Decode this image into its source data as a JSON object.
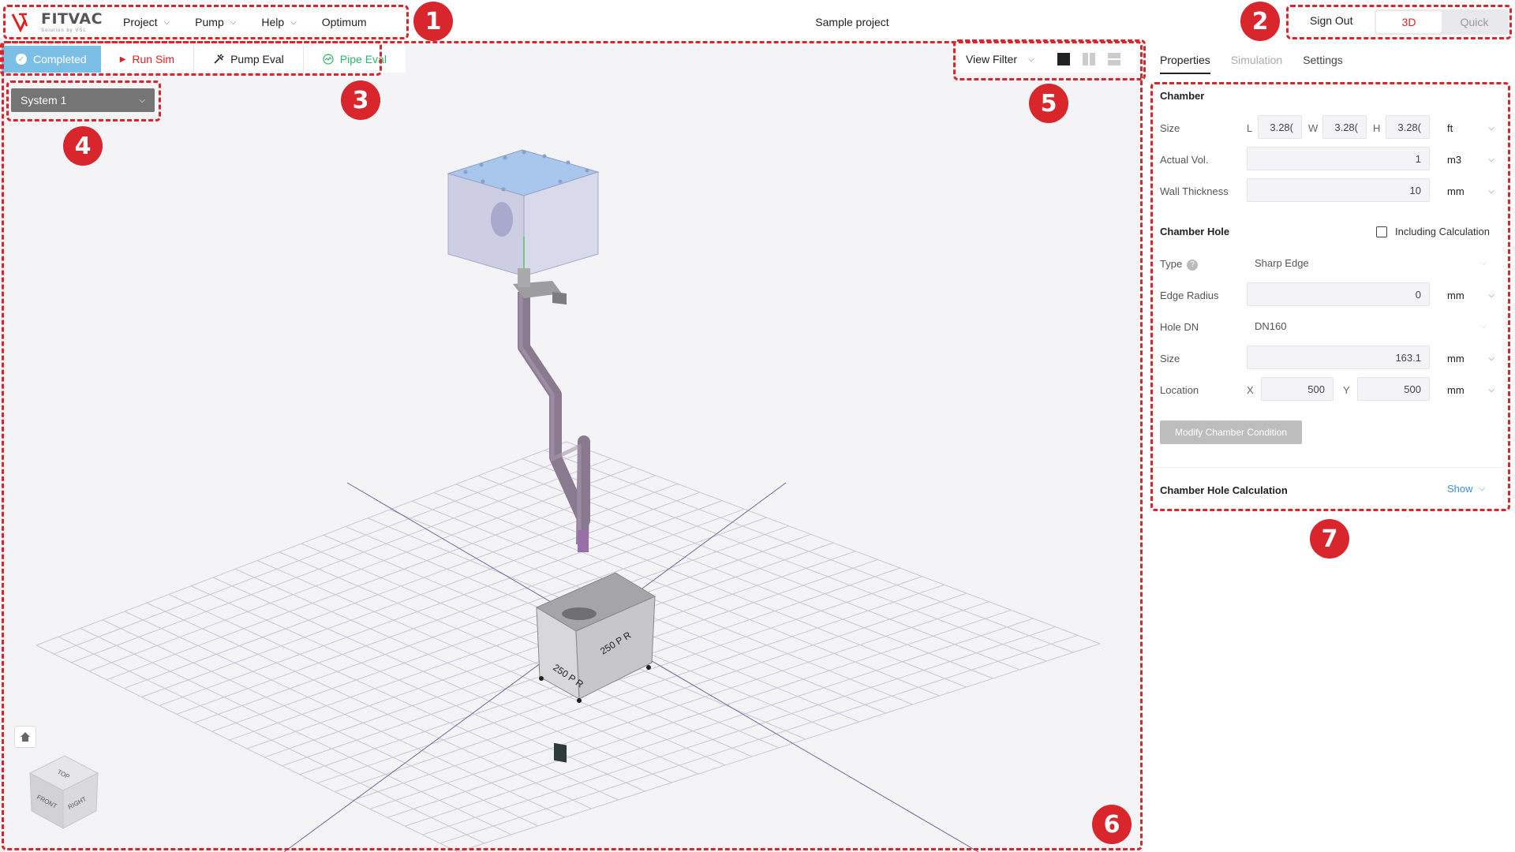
{
  "app": {
    "logo_text": "FITVAC",
    "logo_sub": "Solution by VSL",
    "project_name": "Sample project"
  },
  "menu": [
    {
      "label": "Project",
      "has_dropdown": true
    },
    {
      "label": "Pump",
      "has_dropdown": true
    },
    {
      "label": "Help",
      "has_dropdown": true
    },
    {
      "label": "Optimum",
      "has_dropdown": false
    }
  ],
  "header_right": {
    "signout": "Sign Out",
    "modes": [
      {
        "label": "3D",
        "active": true
      },
      {
        "label": "Quick",
        "active": false
      }
    ]
  },
  "toolbar": {
    "completed": "Completed",
    "run_sim": "Run Sim",
    "pump_eval": "Pump Eval",
    "pipe_eval": "Pipe Eval"
  },
  "system_select": {
    "value": "System 1"
  },
  "view_filter": {
    "label": "View Filter"
  },
  "viewcube": {
    "top": "TOP",
    "front": "FRONT",
    "right": "RIGHT"
  },
  "pump_label": "250 P R",
  "panel": {
    "tabs": [
      {
        "label": "Properties",
        "state": "active"
      },
      {
        "label": "Simulation",
        "state": "muted"
      },
      {
        "label": "Settings",
        "state": "normal"
      }
    ],
    "chamber": {
      "title": "Chamber",
      "size_label": "Size",
      "L": "L",
      "W": "W",
      "H": "H",
      "l_val": "3.28(",
      "w_val": "3.28(",
      "h_val": "3.28(",
      "size_unit": "ft",
      "vol_label": "Actual Vol.",
      "vol_val": "1",
      "vol_unit": "m3",
      "wall_label": "Wall Thickness",
      "wall_val": "10",
      "wall_unit": "mm"
    },
    "hole": {
      "title": "Chamber Hole",
      "including_calc": "Including Calculation",
      "type_label": "Type",
      "type_val": "Sharp Edge",
      "edge_label": "Edge Radius",
      "edge_val": "0",
      "edge_unit": "mm",
      "dn_label": "Hole DN",
      "dn_val": "DN160",
      "size_label": "Size",
      "size_val": "163.1",
      "size_unit": "mm",
      "loc_label": "Location",
      "x_letter": "X",
      "x_val": "500",
      "y_letter": "Y",
      "y_val": "500",
      "loc_unit": "mm",
      "modify_btn": "Modify Chamber Condition"
    },
    "hole_calc": {
      "title": "Chamber Hole Calculation",
      "show": "Show"
    }
  },
  "callouts": [
    "1",
    "2",
    "3",
    "4",
    "5",
    "6",
    "7"
  ],
  "colors": {
    "accent_red": "#d9262c",
    "completed_blue": "#7bbfe6",
    "pipe_green": "#2fb36d",
    "link_blue": "#3a8fd8"
  }
}
